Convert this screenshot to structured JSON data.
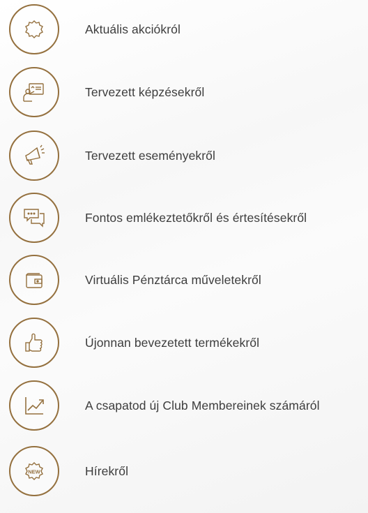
{
  "accent": "#94703e",
  "items": [
    {
      "label": "Aktuális akciókról",
      "icon": "percent-badge-icon"
    },
    {
      "label": "Tervezett képzésekről",
      "icon": "presentation-icon"
    },
    {
      "label": "Tervezett eseményekről",
      "icon": "megaphone-icon"
    },
    {
      "label": "Fontos emlékeztetőkről és értesítésekről",
      "icon": "chat-bubbles-icon"
    },
    {
      "label": "Virtuális Pénztárca műveletekről",
      "icon": "wallet-icon"
    },
    {
      "label": "Újonnan bevezetett termékekről",
      "icon": "thumbs-up-icon"
    },
    {
      "label": "A csapatod új Club Membereinek számáról",
      "icon": "growth-chart-icon"
    },
    {
      "label": "Hírekről",
      "icon": "new-badge-icon",
      "badge_text": "NEW",
      "badge_symbol": "%"
    }
  ]
}
